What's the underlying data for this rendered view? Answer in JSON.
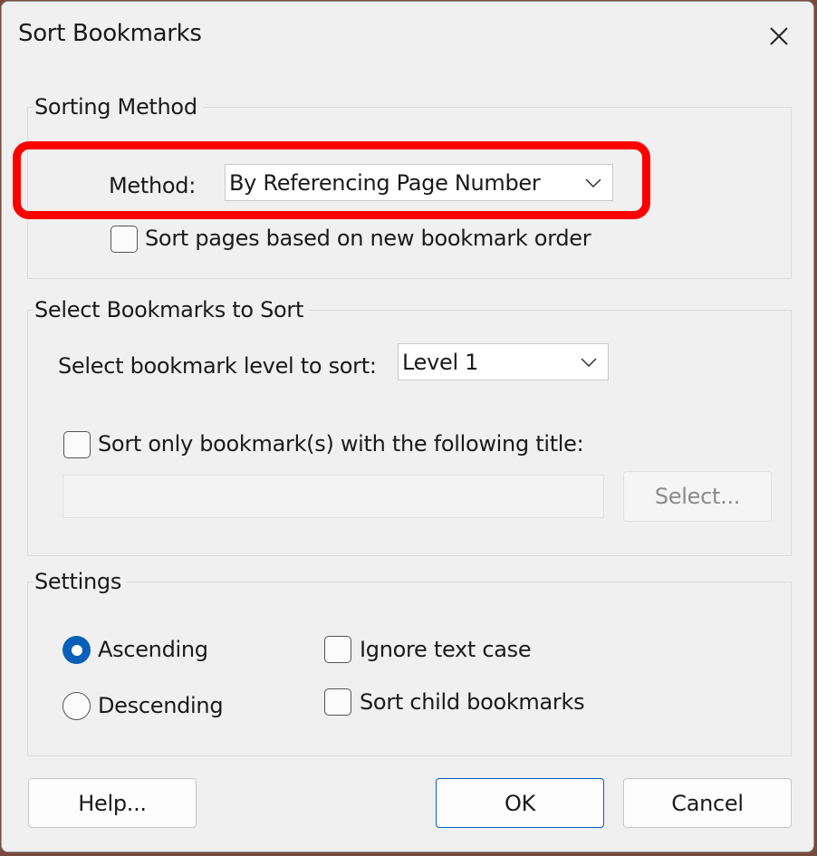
{
  "dialog": {
    "title": "Sort Bookmarks",
    "close_icon": "close-icon"
  },
  "sorting_method": {
    "title": "Sorting Method",
    "method_label": "Method:",
    "method_value": "By Referencing Page Number",
    "sort_pages_label": "Sort pages based on new bookmark order",
    "sort_pages_checked": false,
    "highlight_color": "#ff0000"
  },
  "select_bookmarks": {
    "title": "Select Bookmarks to Sort",
    "level_label": "Select bookmark level to sort:",
    "level_value": "Level 1",
    "title_only_label": "Sort only bookmark(s) with the following title:",
    "title_only_checked": false,
    "title_value": "",
    "select_button_label": "Select..."
  },
  "settings": {
    "title": "Settings",
    "ascending_label": "Ascending",
    "descending_label": "Descending",
    "selected_order": "Ascending",
    "ignore_case_label": "Ignore text case",
    "ignore_case_checked": false,
    "sort_child_label": "Sort child bookmarks",
    "sort_child_checked": false
  },
  "buttons": {
    "help_label": "Help...",
    "ok_label": "OK",
    "cancel_label": "Cancel"
  },
  "colors": {
    "accent": "#0a5fb8",
    "dialog_bg": "#f0f0f0"
  }
}
